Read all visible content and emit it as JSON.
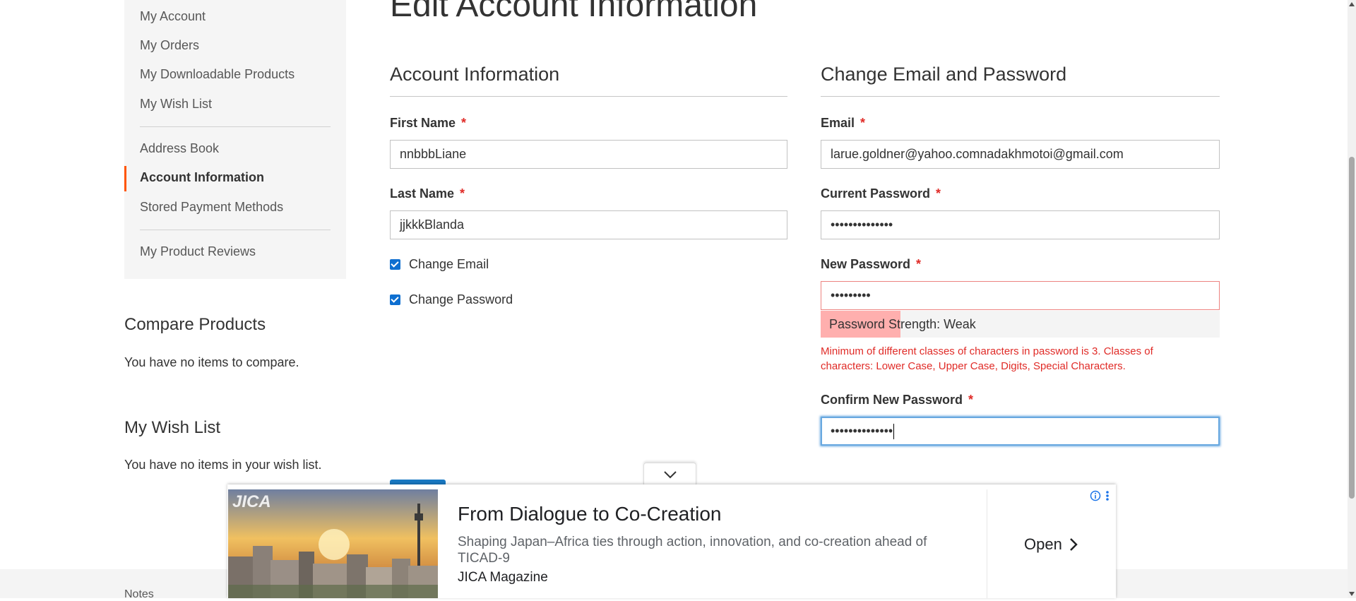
{
  "sidebar": {
    "items": [
      {
        "label": "My Account"
      },
      {
        "label": "My Orders"
      },
      {
        "label": "My Downloadable Products"
      },
      {
        "label": "My Wish List"
      },
      {
        "label": "Address Book"
      },
      {
        "label": "Account Information"
      },
      {
        "label": "Stored Payment Methods"
      },
      {
        "label": "My Product Reviews"
      }
    ],
    "active_item": "Account Information"
  },
  "compare": {
    "title": "Compare Products",
    "empty_text": "You have no items to compare."
  },
  "wishlist": {
    "title": "My Wish List",
    "empty_text": "You have no items in your wish list."
  },
  "page": {
    "title": "Edit Account Information"
  },
  "account_info": {
    "legend": "Account Information",
    "first_name_label": "First Name",
    "first_name_value": "nnbbbLiane",
    "last_name_label": "Last Name",
    "last_name_value": "jjkkkBlanda",
    "change_email_label": "Change Email",
    "change_email_checked": true,
    "change_password_label": "Change Password",
    "change_password_checked": true,
    "required_mark": "*"
  },
  "change_email_password": {
    "legend": "Change Email and Password",
    "email_label": "Email",
    "email_value": "larue.goldner@yahoo.comnadakhmotoi@gmail.com",
    "current_password_label": "Current Password",
    "current_password_value": "••••••••••••••",
    "new_password_label": "New Password",
    "new_password_value": "•••••••••",
    "strength_text": "Password Strength: Weak",
    "strength_level": 0.2,
    "error_message": "Minimum of different classes of characters in password is 3. Classes of characters: Lower Case, Upper Case, Digits, Special Characters.",
    "confirm_password_label": "Confirm New Password",
    "confirm_password_value": "••••••••••••••"
  },
  "footer": {
    "link_label": "Notes"
  },
  "ad": {
    "logo": "JICA",
    "headline": "From Dialogue to Co-Creation",
    "description": "Shaping Japan–Africa ties through action, innovation, and co-creation ahead of TICAD-9",
    "source": "JICA Magazine",
    "cta_label": "Open"
  },
  "colors": {
    "accent": "#ff5501",
    "required": "#e02b27",
    "checkbox": "#0e6fd0",
    "strength_weak": "#ffafae",
    "focus": "#68a8e0",
    "button": "#1979c3"
  }
}
